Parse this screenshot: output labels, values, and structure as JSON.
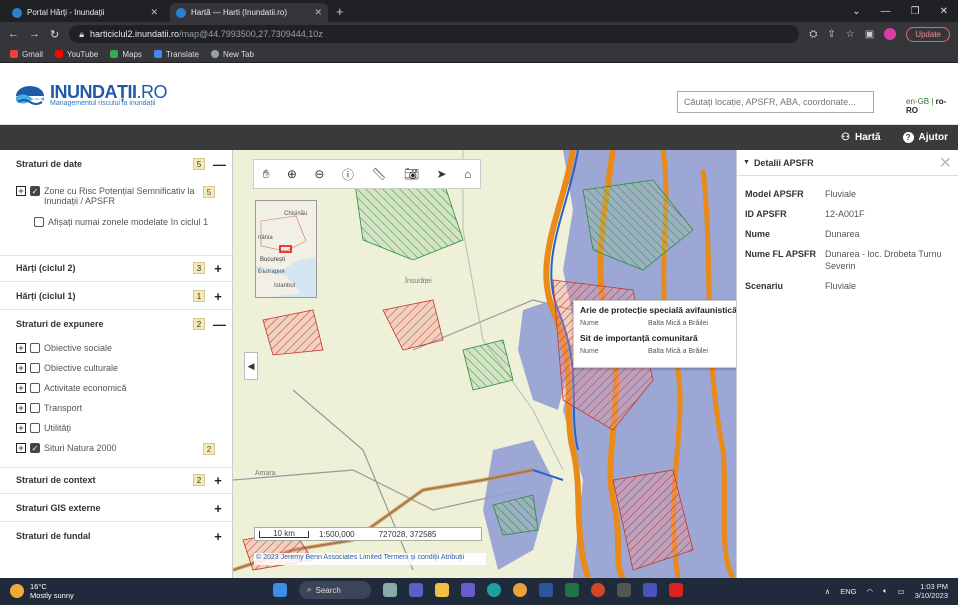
{
  "browser": {
    "tabs": [
      {
        "title": "Portal Hărți - Inundații"
      },
      {
        "title": "Hartă — Harti (Inundatii.ro)"
      }
    ],
    "url_host": "harticiclul2.inundatii.ro",
    "url_path": "/map@44.7993500,27.7309444,10z",
    "update_label": "Update",
    "bookmarks": [
      {
        "label": "Gmail",
        "color": "#ea4335"
      },
      {
        "label": "YouTube",
        "color": "#ff0000"
      },
      {
        "label": "Maps",
        "color": "#34a853"
      },
      {
        "label": "Translate",
        "color": "#4285f4"
      },
      {
        "label": "New Tab",
        "color": "#9aa0a6"
      }
    ]
  },
  "site": {
    "logo_main": "INUNDAȚII",
    "logo_suffix": ".RO",
    "logo_sub": "Managementul riscului la inundații",
    "search_placeholder": "Căutați locație, APSFR, ABA, coordonate...",
    "lang_en": "en-GB |",
    "lang_ro": "ro-RO"
  },
  "toolbar": {
    "map_label": "Hartă",
    "help_label": "Ajutor"
  },
  "left_panel": {
    "sections": [
      {
        "title": "Straturi de date",
        "count": "5",
        "toggle": "—"
      },
      {
        "title": "Hărți (ciclul 2)",
        "count": "3",
        "toggle": "+"
      },
      {
        "title": "Hărți (ciclul 1)",
        "count": "1",
        "toggle": "+"
      },
      {
        "title": "Straturi de expunere",
        "count": "2",
        "toggle": "—"
      },
      {
        "title": "Straturi de context",
        "count": "2",
        "toggle": "+"
      },
      {
        "title": "Straturi GIS externe",
        "count": "",
        "toggle": "+"
      },
      {
        "title": "Straturi de fundal",
        "count": "",
        "toggle": "+"
      }
    ],
    "data_layers": {
      "zone_label": "Zone cu Risc Potențial Semnificativ la Inundații / APSFR",
      "zone_count": "5",
      "only_modelled": "Afișați numai zonele modelate în ciclul 1"
    },
    "exposure_layers": [
      {
        "label": "Obiective sociale",
        "checked": false,
        "count": ""
      },
      {
        "label": "Obiective culturale",
        "checked": false,
        "count": ""
      },
      {
        "label": "Activitate economică",
        "checked": false,
        "count": ""
      },
      {
        "label": "Transport",
        "checked": false,
        "count": ""
      },
      {
        "label": "Utilități",
        "checked": false,
        "count": ""
      },
      {
        "label": "Situri Natura 2000",
        "checked": true,
        "count": "2"
      }
    ]
  },
  "map": {
    "minimap_labels": [
      "Chișinău",
      "nânia",
      "București",
      "Бългaрия",
      "Istanbul"
    ],
    "town_labels": [
      "Însurăței",
      "Amara"
    ],
    "scale_bar": "10 km",
    "scale_ratio": "1:500,000",
    "coords": "727028, 372585",
    "attribution": "© 2023 Jeremy Benn Associates Limited",
    "attribution_terms": "Termeni și condiții",
    "attribution_link": "Atribuții",
    "popup": {
      "title1": "Arie de protecție specială avifaunistică",
      "key1": "Nume",
      "val1": "Balta Mică a Brăilei",
      "title2": "Sit de importanță comunitară",
      "key2": "Nume",
      "val2": "Balta Mică a Brăilei"
    }
  },
  "details": {
    "title": "Detalii APSFR",
    "rows": [
      {
        "k": "Model APSFR",
        "v": "Fluviale"
      },
      {
        "k": "ID APSFR",
        "v": "12-A001F"
      },
      {
        "k": "Nume",
        "v": "Dunarea"
      },
      {
        "k": "Nume FL APSFR",
        "v": "Dunarea - loc. Drobeta Turnu Severin"
      },
      {
        "k": "Scenariu",
        "v": "Fluviale"
      }
    ]
  },
  "taskbar": {
    "temp": "16°C",
    "weather": "Mostly sunny",
    "search_label": "Search",
    "lang": "ENG",
    "time": "1:03 PM",
    "date": "3/10/2023"
  }
}
